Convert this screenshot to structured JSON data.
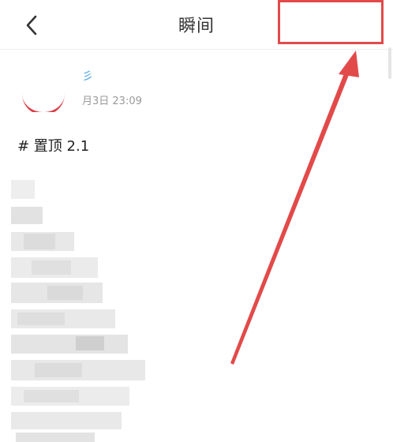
{
  "header": {
    "title": "瞬间",
    "back_icon": "chevron-left-icon",
    "more_icon": "more-vertical-icon"
  },
  "post": {
    "author_fragment": "彡",
    "timestamp": "月3日 23:09",
    "text": "# 置顶 2.1"
  },
  "annotation": {
    "color": "#e24a4a"
  }
}
